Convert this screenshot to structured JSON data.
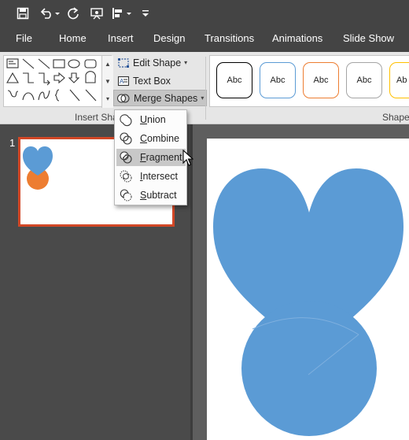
{
  "tabs": [
    {
      "label": "File"
    },
    {
      "label": "Home"
    },
    {
      "label": "Insert"
    },
    {
      "label": "Design"
    },
    {
      "label": "Transitions"
    },
    {
      "label": "Animations"
    },
    {
      "label": "Slide Show"
    }
  ],
  "ribbon": {
    "edit_shape": "Edit Shape",
    "text_box": "Text Box",
    "merge_shapes": "Merge Shapes",
    "group_insert_label": "Insert Sha",
    "group_styles_label": "Shape",
    "style_swatches": [
      {
        "label": "Abc",
        "border": "#000000"
      },
      {
        "label": "Abc",
        "border": "#5b9bd5"
      },
      {
        "label": "Abc",
        "border": "#ed7d31"
      },
      {
        "label": "Abc",
        "border": "#a5a5a5"
      },
      {
        "label": "Ab",
        "border": "#ffc000"
      }
    ]
  },
  "merge_menu": {
    "items": [
      {
        "first": "U",
        "rest": "nion",
        "icon": "union-icon"
      },
      {
        "first": "C",
        "rest": "ombine",
        "icon": "combine-icon"
      },
      {
        "first": "F",
        "rest": "ragment",
        "icon": "fragment-icon"
      },
      {
        "first": "I",
        "rest": "ntersect",
        "icon": "intersect-icon"
      },
      {
        "first": "S",
        "rest": "ubtract",
        "icon": "subtract-icon"
      }
    ],
    "highlighted": "Fragment"
  },
  "thumbnails": {
    "slide_number": "1"
  },
  "colors": {
    "accent_slide_border": "#d24726",
    "shape_blue": "#5b9bd5",
    "shape_orange": "#ed7d31"
  }
}
